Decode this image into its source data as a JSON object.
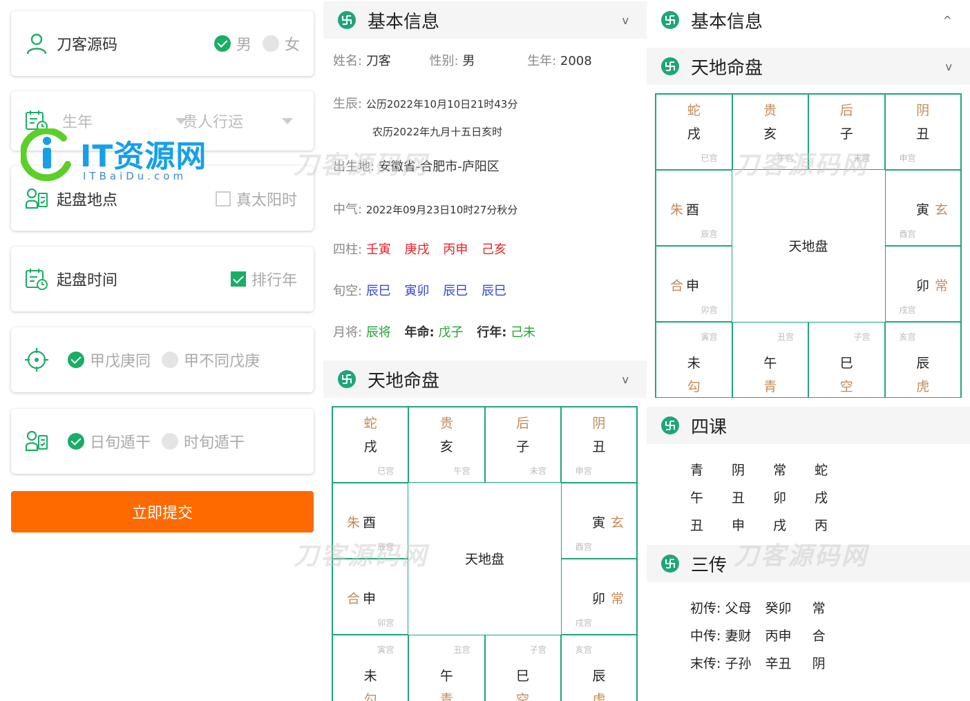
{
  "form": {
    "name_label": "刀客源码",
    "gender_male": "男",
    "gender_female": "女",
    "birth_year": "生年",
    "noble_person": "贵人行运",
    "place_label": "起盘地点",
    "true_solar": "真太阳时",
    "time_label": "起盘时间",
    "rank_year": "排行年",
    "opt_jiawu_same": "甲戊庚同",
    "opt_jiawu_diff": "甲不同戊庚",
    "opt_day_xun": "日旬遁干",
    "opt_hour_xun": "时旬遁干",
    "submit": "立即提交"
  },
  "logo": {
    "text": "IT资源网",
    "sub": "ITBaiDu.com"
  },
  "watermark": "刀客源码网",
  "basic": {
    "title": "基本信息",
    "chev_down": "v",
    "chev_up": "^",
    "name_k": "姓名:",
    "name_v": "刀客",
    "gender_k": "性别:",
    "gender_v": "男",
    "year_k": "生年:",
    "year_v": "2008",
    "birth_k": "生辰:",
    "birth_solar": "公历2022年10月10日21时43分",
    "birth_lunar": "农历2022年九月十五日亥时",
    "place_k": "出生地:",
    "place_v": "安徽省-合肥市-庐阳区",
    "qi_k": "中气:",
    "qi_v": "2022年09月23日10时27分秋分",
    "sizhu_k": "四柱:",
    "sizhu": [
      "壬寅",
      "庚戌",
      "丙申",
      "己亥"
    ],
    "xunkong_k": "旬空:",
    "xunkong": [
      "辰巳",
      "寅卯",
      "辰巳",
      "辰巳"
    ],
    "yuejiang_k": "月将:",
    "yuejiang_v": "辰将",
    "nianming_k": "年命:",
    "nianming_v": "戊子",
    "xingnian_k": "行年:",
    "xingnian_v": "己未"
  },
  "board": {
    "title": "天地命盘",
    "center": "天地盘",
    "top": [
      {
        "god": "蛇",
        "branch": "戌",
        "palace": "巳宫"
      },
      {
        "god": "贵",
        "branch": "亥",
        "palace": "午宫"
      },
      {
        "god": "后",
        "branch": "子",
        "palace": "未宫"
      },
      {
        "god": "阴",
        "branch": "丑",
        "palace": "申宫"
      }
    ],
    "left": [
      {
        "god": "朱",
        "branch": "酉",
        "palace": "辰宫"
      },
      {
        "god": "合",
        "branch": "申",
        "palace": "卯宫"
      }
    ],
    "right": [
      {
        "god": "玄",
        "branch": "寅",
        "palace": "酉宫"
      },
      {
        "god": "常",
        "branch": "卯",
        "palace": "戌宫"
      }
    ],
    "bottom": [
      {
        "god": "勾",
        "branch": "未",
        "palace": "寅宫"
      },
      {
        "god": "青",
        "branch": "午",
        "palace": "丑宫"
      },
      {
        "god": "空",
        "branch": "巳",
        "palace": "子宫"
      },
      {
        "god": "虎",
        "branch": "辰",
        "palace": "亥宫"
      }
    ]
  },
  "sike": {
    "title": "四课",
    "rows": [
      [
        "青",
        "阴",
        "常",
        "蛇"
      ],
      [
        "午",
        "丑",
        "卯",
        "戌"
      ],
      [
        "丑",
        "申",
        "戌",
        "丙"
      ]
    ]
  },
  "sanchuan": {
    "title": "三传",
    "rows": [
      [
        "初传:",
        "父母",
        "癸卯",
        "常"
      ],
      [
        "中传:",
        "妻财",
        "丙申",
        "合"
      ],
      [
        "末传:",
        "子孙",
        "辛丑",
        "阴"
      ]
    ]
  },
  "colors": {
    "accent": "#1aad66",
    "submit": "#ff6a00",
    "grid": "#1ea67b",
    "god": "#c48a56"
  }
}
